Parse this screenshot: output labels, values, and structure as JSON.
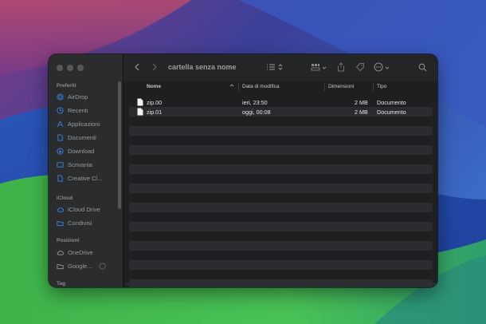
{
  "window": {
    "title": "cartella senza nome"
  },
  "sidebar": {
    "sections": [
      {
        "label": "Preferiti"
      },
      {
        "label": "iCloud"
      },
      {
        "label": "Posizioni"
      },
      {
        "label": "Tag"
      }
    ],
    "favorites": [
      {
        "label": "AirDrop",
        "icon": "airdrop-icon"
      },
      {
        "label": "Recenti",
        "icon": "clock-icon"
      },
      {
        "label": "Applicazioni",
        "icon": "apps-icon"
      },
      {
        "label": "Documenti",
        "icon": "document-icon"
      },
      {
        "label": "Download",
        "icon": "download-icon"
      },
      {
        "label": "Scrivania",
        "icon": "desktop-icon"
      },
      {
        "label": "Creative Cl...",
        "icon": "document-icon"
      }
    ],
    "icloud": [
      {
        "label": "iCloud Drive",
        "icon": "cloud-icon"
      },
      {
        "label": "Condivisi",
        "icon": "shared-folder-icon"
      }
    ],
    "locations": [
      {
        "label": "OneDrive",
        "icon": "cloud-icon"
      },
      {
        "label": "Google...",
        "icon": "folder-icon"
      }
    ]
  },
  "columns": {
    "name": "Nome",
    "date": "Data di modifica",
    "size": "Dimensioni",
    "kind": "Tipo"
  },
  "files": [
    {
      "name": "zip.00",
      "date": "ieri, 23:50",
      "size": "2 MB",
      "kind": "Documento"
    },
    {
      "name": "zip.01",
      "date": "oggi, 00:08",
      "size": "2 MB",
      "kind": "Documento"
    }
  ],
  "colors": {
    "window_bg": "#1f2022",
    "sidebar_bg": "#2b2c2e",
    "row_alt": "#2b2c2f"
  }
}
